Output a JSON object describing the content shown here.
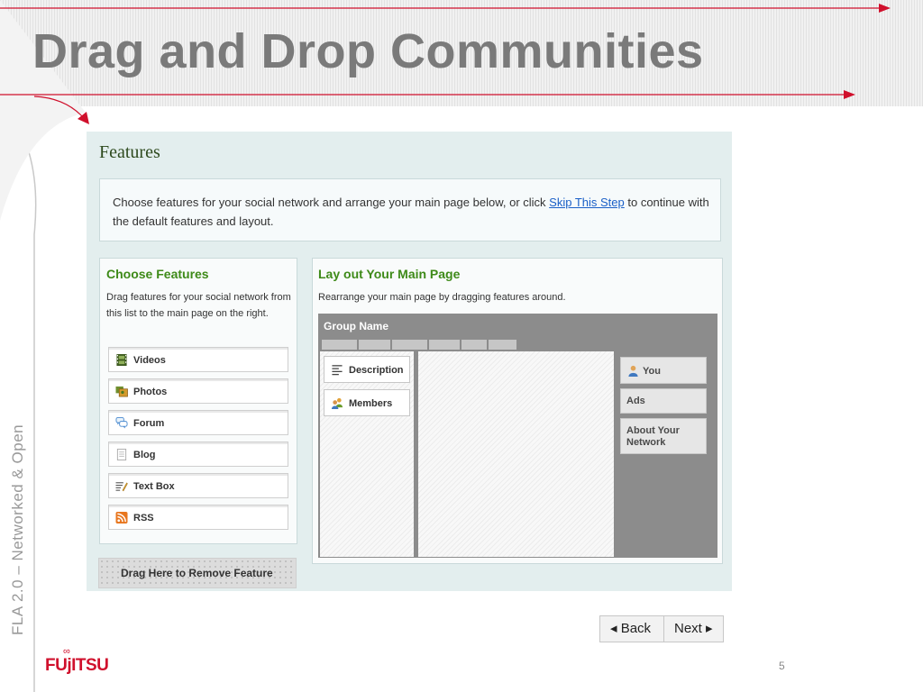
{
  "slide": {
    "title": "Drag and Drop Communities",
    "side_text": "FLA 2.0  – Networked & Open",
    "logo": "FUjITSU",
    "page_number": "5",
    "accent_color": "#d0102c"
  },
  "features": {
    "title": "Features",
    "intro_before_link": "Choose features for your social network and arrange your main page below, or click ",
    "intro_link": "Skip This Step",
    "intro_after_link": " to continue with the default features and layout."
  },
  "choose": {
    "title": "Choose Features",
    "description": "Drag features for your social network from this list to the main page on the right.",
    "items": [
      {
        "label": "Videos",
        "icon": "film-icon"
      },
      {
        "label": "Photos",
        "icon": "photos-icon"
      },
      {
        "label": "Forum",
        "icon": "speech-bubbles-icon"
      },
      {
        "label": "Blog",
        "icon": "page-icon"
      },
      {
        "label": "Text Box",
        "icon": "text-pencil-icon"
      },
      {
        "label": "RSS",
        "icon": "rss-icon"
      }
    ]
  },
  "layout": {
    "title": "Lay out Your Main Page",
    "description": "Rearrange your main page by dragging features around.",
    "group_name": "Group Name",
    "left_items": [
      {
        "label": "Description",
        "icon": "lines-icon"
      },
      {
        "label": "Members",
        "icon": "people-icon"
      }
    ],
    "right_items": [
      {
        "label": "You",
        "icon": "person-icon"
      },
      {
        "label": "Ads"
      },
      {
        "label": "About Your Network"
      }
    ]
  },
  "remove_zone": "Drag Here to Remove Feature",
  "nav": {
    "back": "◂ Back",
    "next": "Next ▸"
  }
}
